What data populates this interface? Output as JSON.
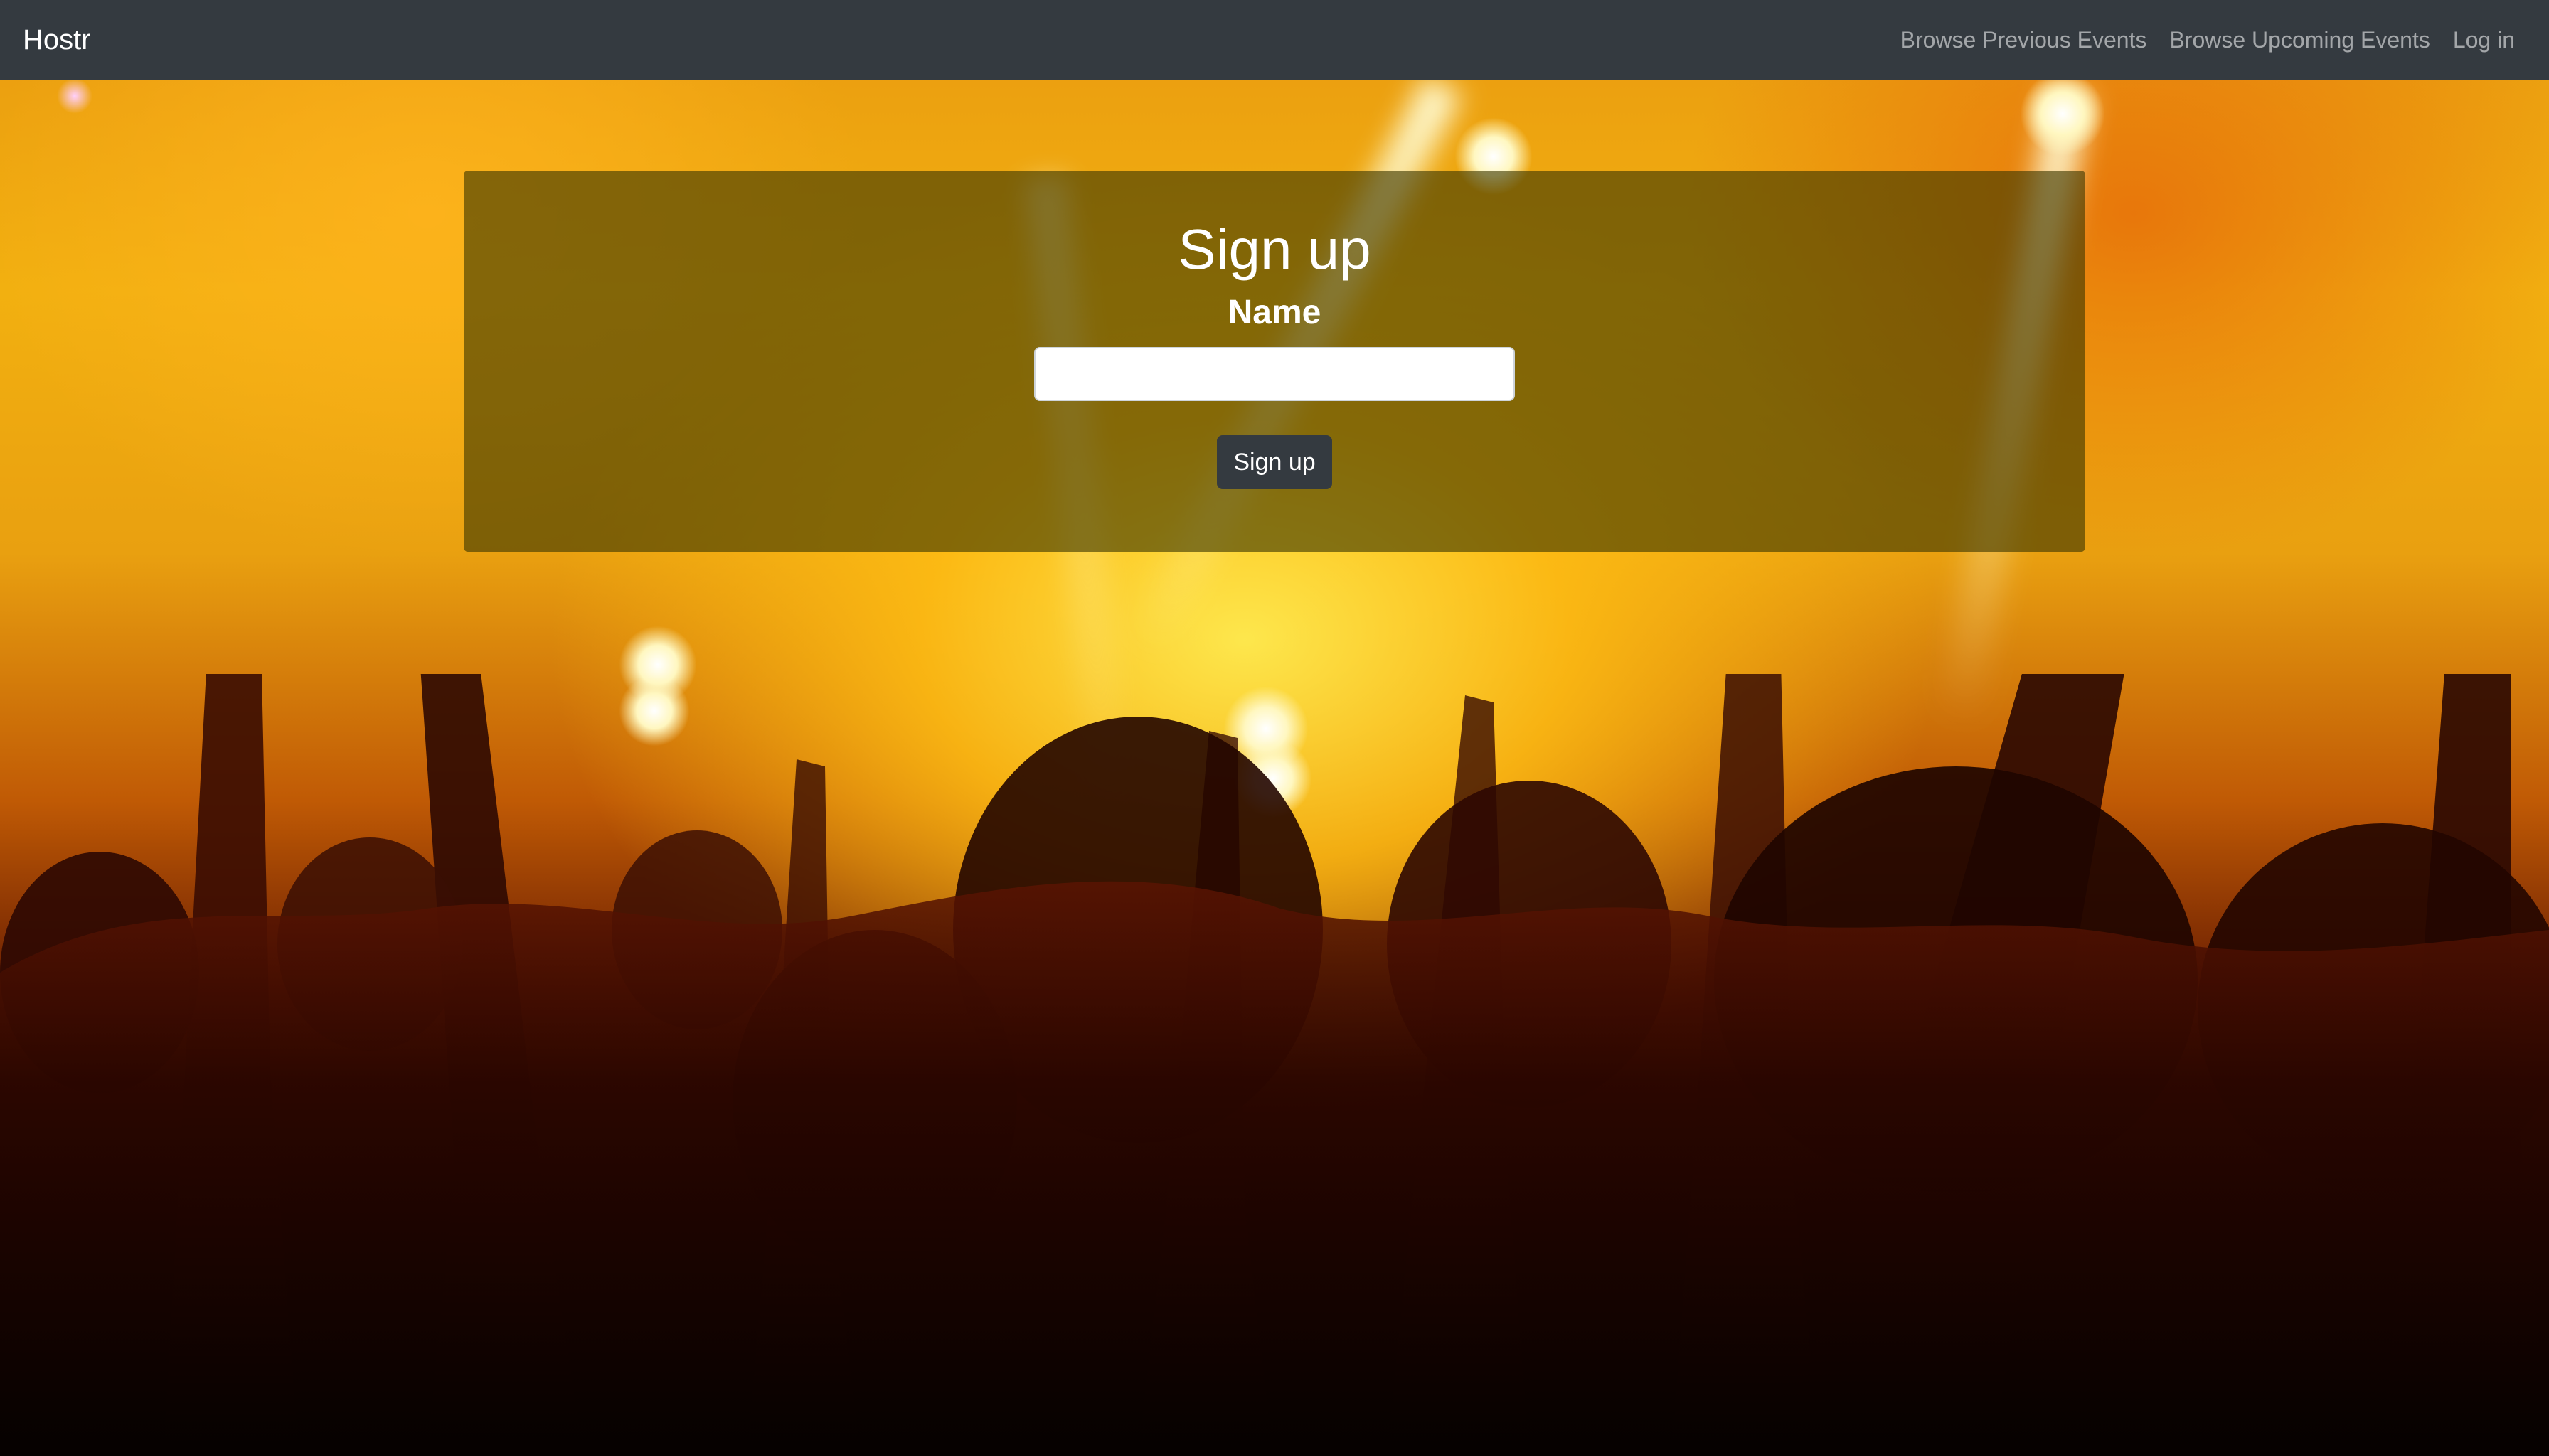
{
  "navbar": {
    "brand": "Hostr",
    "links": [
      {
        "label": "Browse Previous Events"
      },
      {
        "label": "Browse Upcoming Events"
      },
      {
        "label": "Log in"
      }
    ]
  },
  "signup_form": {
    "title": "Sign up",
    "name_label": "Name",
    "name_value": "",
    "submit_label": "Sign up"
  },
  "colors": {
    "navbar_bg": "#343a40",
    "button_bg": "#343a40",
    "panel_overlay": "rgba(60,55,0,0.62)"
  }
}
